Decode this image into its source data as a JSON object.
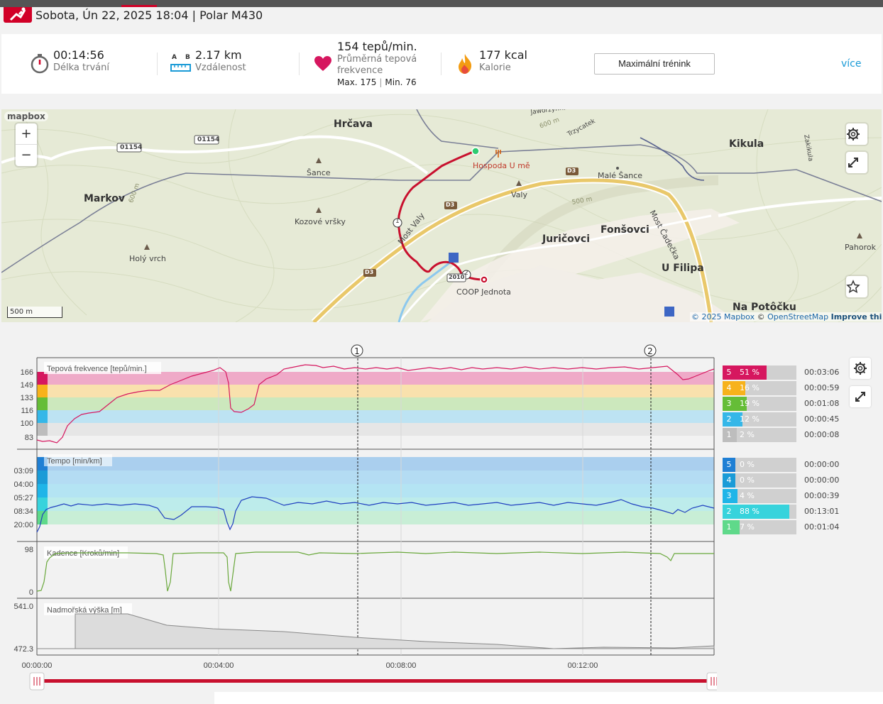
{
  "header": {
    "title": "Sobota, Ún 22, 2025 18:04 | Polar M430"
  },
  "summary": {
    "duration": {
      "value": "00:14:56",
      "label": "Délka trvání"
    },
    "distance": {
      "value": "2.17 km",
      "label": "Vzdálenost",
      "icon_a": "A",
      "icon_b": "B"
    },
    "heart_rate": {
      "value": "154 tepů/min.",
      "label_1": "Průměrná tepová",
      "label_2": "frekvence",
      "max": "Max. 175",
      "sep": "|",
      "min": "Min. 76"
    },
    "calories": {
      "value": "177 kcal",
      "label": "Kalorie"
    },
    "benefit_button": "Maximální trénink",
    "more_link": "více"
  },
  "map": {
    "logo": "mapbox",
    "zoom_in": "+",
    "zoom_out": "−",
    "scale": "500 m",
    "attribution_prefix": "© 2025 Mapbox",
    "attribution_sep": "©",
    "attribution_osm": "OpenStreetMap",
    "improve": "Improve this map",
    "labels": {
      "hrcava": "Hrčava",
      "kikula": "Kikula",
      "markov": "Markov",
      "sance": "Šance",
      "male_sance": "Malé Šance",
      "valy": "Valy",
      "kozove": "Kozové vršky",
      "holy": "Holý vrch",
      "juricovci": "Juričovci",
      "fonsovci": "Fonšovci",
      "u_filipa": "U Filipa",
      "na_potocku": "Na Potôčku",
      "pahorok": "Pahorok",
      "hospoda": "Hospoda U mě",
      "coop": "COOP Jednota",
      "most": "Most Čadečka",
      "most_valy": "Most Valy",
      "trzycatek": "Trzycatek",
      "r01154a": "01154",
      "r01154b": "01154",
      "d3a": "D3",
      "d3b": "D3",
      "d3c": "D3",
      "r2010": "2010",
      "lap1": "1",
      "lap2": "2",
      "c600a": "600 m",
      "c600b": "600 m",
      "c500": "500 m",
      "zakikula": "Zakikula",
      "javorzynka": "Jaworzynka"
    }
  },
  "charts": {
    "hr_label": "Tepová frekvence [tepů/min.]",
    "pace_label": "Tempo [min/km]",
    "cadence_label": "Kadence [Kroků/min]",
    "altitude_label": "Nadmořská výška [m]",
    "hr_ticks": [
      "166",
      "149",
      "133",
      "116",
      "100",
      "83"
    ],
    "pace_ticks": [
      "03:09",
      "04:00",
      "05:27",
      "08:34",
      "20:00"
    ],
    "cadence_ticks": [
      "98",
      "0"
    ],
    "altitude_ticks": [
      "541.0",
      "472.3"
    ],
    "time_ticks": [
      "00:00:00",
      "00:04:00",
      "00:08:00",
      "00:12:00"
    ],
    "laps": [
      "1",
      "2"
    ]
  },
  "hr_zones": [
    {
      "zone": "5",
      "pct": "51 %",
      "time": "00:03:06",
      "fraction": 0.51,
      "color": "#d6175f"
    },
    {
      "zone": "4",
      "pct": "16 %",
      "time": "00:00:59",
      "fraction": 0.16,
      "color": "#f7b21b"
    },
    {
      "zone": "3",
      "pct": "19 %",
      "time": "00:01:08",
      "fraction": 0.19,
      "color": "#65bd37"
    },
    {
      "zone": "2",
      "pct": "12 %",
      "time": "00:00:45",
      "fraction": 0.12,
      "color": "#35b7e8"
    },
    {
      "zone": "1",
      "pct": "2 %",
      "time": "00:00:08",
      "fraction": 0.02,
      "color": "#bdbdbd"
    }
  ],
  "pace_zones": [
    {
      "zone": "5",
      "pct": "0 %",
      "time": "00:00:00",
      "fraction": 0.0,
      "color": "#1f7fd4"
    },
    {
      "zone": "4",
      "pct": "0 %",
      "time": "00:00:00",
      "fraction": 0.0,
      "color": "#1a9bd7"
    },
    {
      "zone": "3",
      "pct": "4 %",
      "time": "00:00:39",
      "fraction": 0.04,
      "color": "#1fb5e8"
    },
    {
      "zone": "2",
      "pct": "88 %",
      "time": "00:13:01",
      "fraction": 0.88,
      "color": "#37d3dc"
    },
    {
      "zone": "1",
      "pct": "7 %",
      "time": "00:01:04",
      "fraction": 0.07,
      "color": "#5fd98a"
    }
  ],
  "colors": {
    "accent": "#d10027",
    "link": "#1a9bd7",
    "hr_line": "#d6175f",
    "pace_line": "#2040c0",
    "cadence_line": "#6aa83c"
  }
}
